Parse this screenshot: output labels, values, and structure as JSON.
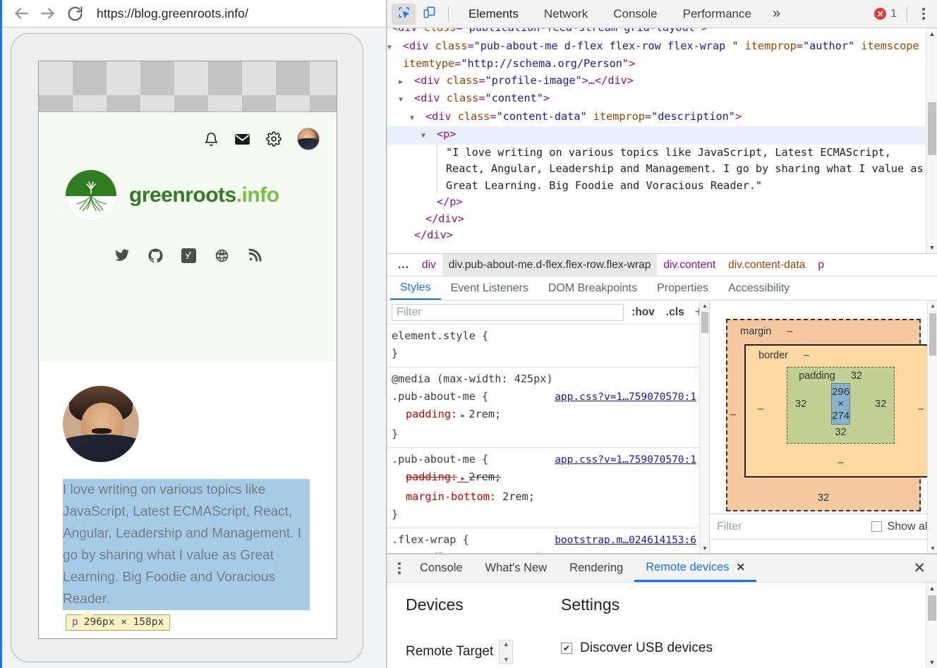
{
  "browser": {
    "url": "https://blog.greenroots.info/",
    "back_icon": "arrow-left-icon",
    "forward_icon": "arrow-right-icon",
    "reload_icon": "reload-icon"
  },
  "preview": {
    "site": {
      "logo_text_main": "greenroots",
      "logo_text_suffix": ".info",
      "header_icons": [
        "bell-icon",
        "mail-icon",
        "gear-icon",
        "user-avatar"
      ],
      "social_icons": [
        "twitter-icon",
        "github-icon",
        "hashnode-icon",
        "globe-icon",
        "rss-icon"
      ],
      "bio_text": "I love writing on various topics like JavaScript, Latest ECMAScript, React, Angular, Leadership and Management. I go by sharing what I value as Great Learning. Big Foodie and Voracious Reader."
    },
    "tooltip": {
      "tag": "p",
      "dimensions": "296px × 158px"
    },
    "highlight_color": "#a6cbe7",
    "tooltip_bg": "#fcf3c4"
  },
  "devtools": {
    "toolbar": {
      "inspect_icon": "inspect-element-icon",
      "device_toggle_icon": "device-toolbar-icon",
      "tabs": [
        "Elements",
        "Network",
        "Console",
        "Performance"
      ],
      "selected_tab": "Elements",
      "more_tabs_icon": "»",
      "error_count": "1",
      "error_icon": "error-circle-icon",
      "menu_icon": "vertical-dots-icon",
      "accent_color": "#1a73e8",
      "error_color": "#e53935"
    },
    "dom": [
      {
        "indent": 0,
        "caret": "▼",
        "clipped": true,
        "parts": [
          {
            "t": "pk",
            "s": "<div "
          },
          {
            "t": "at",
            "s": "class"
          },
          {
            "t": "pk",
            "s": "="
          },
          {
            "t": "av",
            "s": "\"publication-feed-stream grid-layout\""
          },
          {
            "t": "pk",
            "s": ">"
          }
        ]
      },
      {
        "indent": 1,
        "caret": "▼",
        "parts": [
          {
            "t": "pk",
            "s": "<div "
          },
          {
            "t": "at",
            "s": "class"
          },
          {
            "t": "pk",
            "s": "="
          },
          {
            "t": "av",
            "s": "\"pub-about-me d-flex flex-row flex-wrap \""
          },
          {
            "t": "pk",
            "s": " "
          },
          {
            "t": "at",
            "s": "itemprop"
          },
          {
            "t": "pk",
            "s": "="
          },
          {
            "t": "av",
            "s": "\"author\""
          },
          {
            "t": "pk",
            "s": " "
          },
          {
            "t": "at",
            "s": "itemscope"
          },
          {
            "t": "pk",
            "s": " "
          },
          {
            "t": "at",
            "s": "itemtype"
          },
          {
            "t": "pk",
            "s": "="
          },
          {
            "t": "av",
            "s": "\"http://schema.org/Person\""
          },
          {
            "t": "pk",
            "s": ">"
          }
        ]
      },
      {
        "indent": 2,
        "caret": "▶",
        "parts": [
          {
            "t": "pk",
            "s": "<div "
          },
          {
            "t": "at",
            "s": "class"
          },
          {
            "t": "pk",
            "s": "="
          },
          {
            "t": "av",
            "s": "\"profile-image\""
          },
          {
            "t": "pk",
            "s": ">…</div>"
          }
        ]
      },
      {
        "indent": 2,
        "caret": "▼",
        "parts": [
          {
            "t": "pk",
            "s": "<div "
          },
          {
            "t": "at",
            "s": "class"
          },
          {
            "t": "pk",
            "s": "="
          },
          {
            "t": "av",
            "s": "\"content\""
          },
          {
            "t": "pk",
            "s": ">"
          }
        ]
      },
      {
        "indent": 3,
        "caret": "▼",
        "parts": [
          {
            "t": "pk",
            "s": "<div "
          },
          {
            "t": "at",
            "s": "class"
          },
          {
            "t": "pk",
            "s": "="
          },
          {
            "t": "av",
            "s": "\"content-data\""
          },
          {
            "t": "pk",
            "s": " "
          },
          {
            "t": "at",
            "s": "itemprop"
          },
          {
            "t": "pk",
            "s": "="
          },
          {
            "t": "av",
            "s": "\"description\""
          },
          {
            "t": "pk",
            "s": ">"
          }
        ]
      },
      {
        "indent": 4,
        "caret": "▼",
        "selected": true,
        "parts": [
          {
            "t": "pk",
            "s": "<p>"
          }
        ]
      },
      {
        "indent": 5,
        "caret": "",
        "parts": [
          {
            "t": "txt",
            "s": "\"I love writing on various topics like JavaScript, Latest ECMAScript, React, Angular, Leadership and Management. I go by sharing what I value as Great Learning. Big Foodie and Voracious Reader.\""
          }
        ]
      },
      {
        "indent": 4,
        "caret": "",
        "parts": [
          {
            "t": "pk",
            "s": "</p>"
          }
        ]
      },
      {
        "indent": 3,
        "caret": "",
        "parts": [
          {
            "t": "pk",
            "s": "</div>"
          }
        ]
      },
      {
        "indent": 2,
        "caret": "",
        "clipped_bottom": true,
        "parts": [
          {
            "t": "pk",
            "s": "</div>"
          }
        ]
      }
    ],
    "breadcrumbs": [
      {
        "label": "...",
        "kind": "dots"
      },
      {
        "label": "div",
        "kind": "tag"
      },
      {
        "label": "div.pub-about-me.d-flex.flex-row.flex-wrap",
        "kind": "selected"
      },
      {
        "label": "div.content",
        "kind": "tag"
      },
      {
        "label": "div.content-data",
        "kind": "brown"
      },
      {
        "label": "p",
        "kind": "tag"
      }
    ],
    "subtabs": [
      "Styles",
      "Event Listeners",
      "DOM Breakpoints",
      "Properties",
      "Accessibility"
    ],
    "selected_subtab": "Styles",
    "styles_filter": {
      "placeholder": "Filter",
      "hov": ":hov",
      "cls": ".cls",
      "add": "+"
    },
    "style_rules": [
      {
        "media": "",
        "selector": "element.style {",
        "origin": "",
        "declarations": [],
        "close": "}"
      },
      {
        "media": "@media (max-width: 425px)",
        "selector": ".pub-about-me {",
        "origin": "app.css?v=1…759070570:1",
        "declarations": [
          {
            "prop": "padding:",
            "value": "2rem;",
            "struck": false,
            "expandable": true
          }
        ],
        "close": "}"
      },
      {
        "media": "",
        "selector": ".pub-about-me {",
        "origin": "app.css?v=1…759070570:1",
        "declarations": [
          {
            "prop": "padding:",
            "value": "2rem;",
            "struck": true,
            "expandable": true
          },
          {
            "prop": "margin-bottom:",
            "value": "2rem;",
            "struck": false,
            "expandable": false
          }
        ],
        "close": "}"
      },
      {
        "media": "",
        "selector": ".flex-wrap {",
        "origin": "bootstrap.m…024614153:6",
        "declarations": [
          {
            "prop": "-ms-flex-wrap:",
            "value": "wrap!important;",
            "struck": false,
            "expandable": false
          }
        ],
        "close": ""
      }
    ],
    "box_model": {
      "margin_label": "margin",
      "border_label": "border",
      "padding_label": "padding",
      "margin_top": "–",
      "margin_right": "–",
      "margin_bottom": "32",
      "margin_left": "–",
      "border_top": "–",
      "border_right": "–",
      "border_bottom": "–",
      "border_left": "–",
      "padding_top": "32",
      "padding_right": "32",
      "padding_bottom": "32",
      "padding_left": "32",
      "content_size": "296 × 274",
      "colors": {
        "margin": "#f6c9a0",
        "border": "#fbd9a0",
        "padding": "#c3cf92",
        "content": "#87b2cc"
      }
    },
    "computed_filter": {
      "placeholder": "Filter",
      "show_all_label": "Show all",
      "show_all_checked": false
    },
    "drawer": {
      "menu_icon": "vertical-dots-icon",
      "tabs": [
        "Console",
        "What's New",
        "Rendering",
        "Remote devices"
      ],
      "selected_tab": "Remote devices",
      "tab_close_icon": "✕",
      "close_icon": "✕",
      "devices_heading": "Devices",
      "settings_heading": "Settings",
      "remote_target_label": "Remote Target",
      "discover_usb_label": "Discover USB devices",
      "discover_usb_checked": true,
      "checkmark": "✔"
    }
  }
}
